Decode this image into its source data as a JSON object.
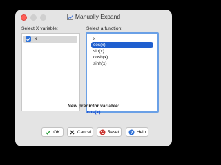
{
  "window": {
    "title": "Manually Expand"
  },
  "left_panel": {
    "label": "Select X variable:",
    "items": [
      {
        "label": "x",
        "checked": true
      }
    ]
  },
  "right_panel": {
    "label": "Select a function:",
    "items": [
      "x",
      "cos(x)",
      "sin(x)",
      "cosh(x)",
      "sinh(x)"
    ],
    "selected": "cos(x)"
  },
  "new_variable": {
    "label": "New predictor variable:",
    "value": "cos(x)"
  },
  "buttons": {
    "ok": "OK",
    "cancel": "Cancel",
    "reset": "Reset",
    "help": "Help"
  },
  "colors": {
    "selection": "#1f5fcf",
    "accent_text": "#1a4fd0",
    "checkbox": "#2d72d9"
  }
}
